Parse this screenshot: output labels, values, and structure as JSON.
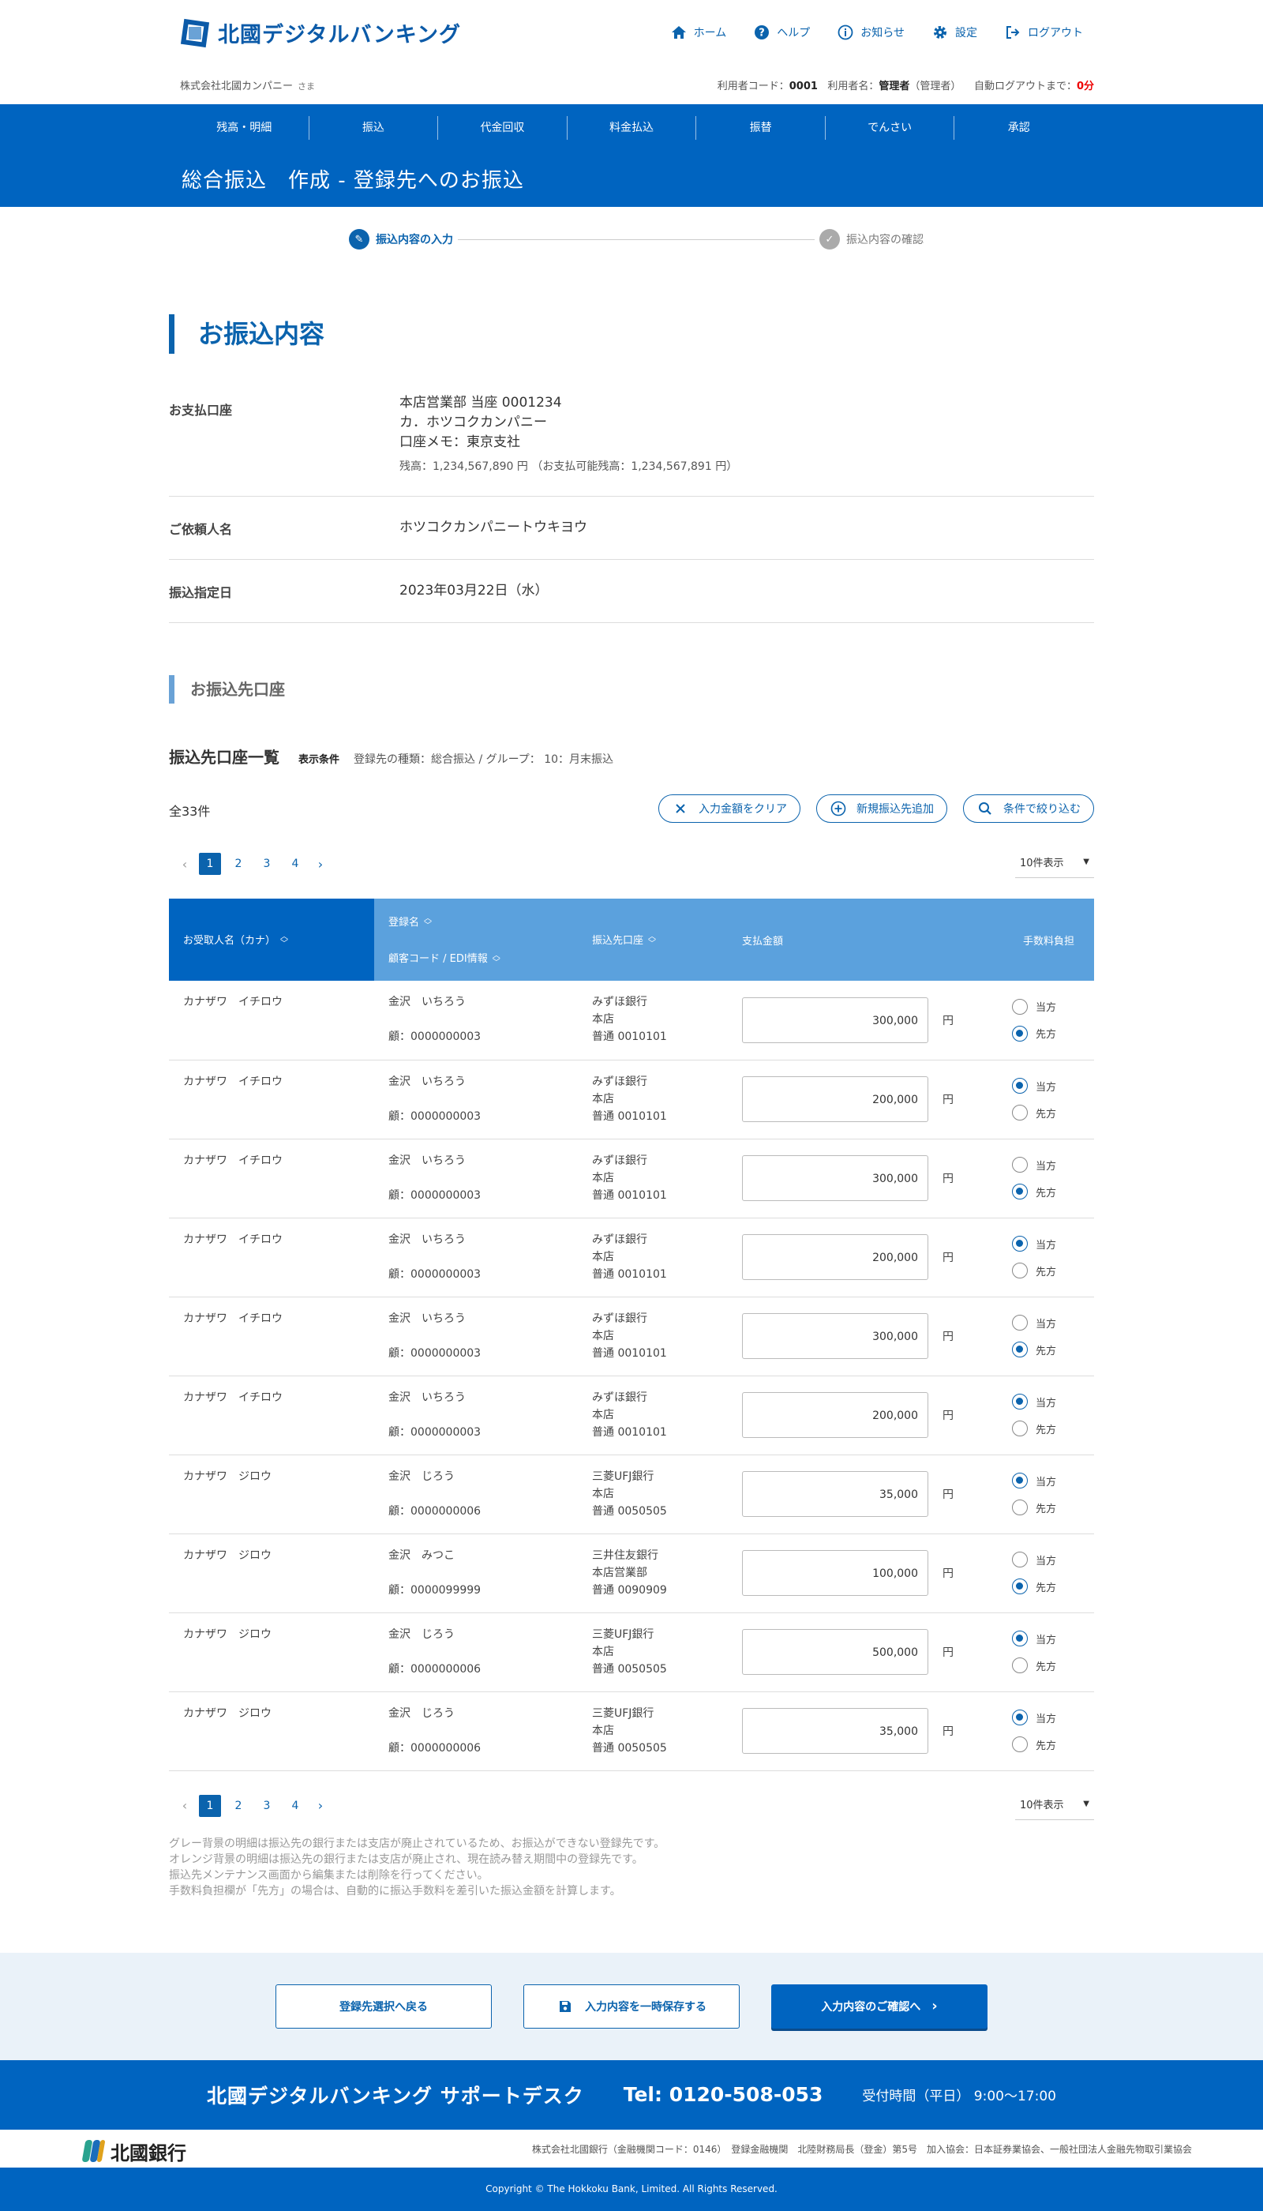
{
  "brand": {
    "name": "北國デジタルバンキング"
  },
  "topnav": [
    {
      "label": "ホーム",
      "icon": "home-icon"
    },
    {
      "label": "ヘルプ",
      "icon": "help-icon"
    },
    {
      "label": "お知らせ",
      "icon": "info-icon"
    },
    {
      "label": "設定",
      "icon": "gear-icon"
    },
    {
      "label": "ログアウト",
      "icon": "logout-icon"
    }
  ],
  "user": {
    "company": "株式会社北國カンパニー",
    "suffix": "さま",
    "code_label": "利用者コード：",
    "code": "0001",
    "name_label": "利用者名：",
    "name": "管理者",
    "role": "（管理者）",
    "logout_label": "自動ログアウトまで：",
    "logout_time": "0分"
  },
  "mainnav": [
    "残高・明細",
    "振込",
    "代金回収",
    "料金払込",
    "振替",
    "でんさい",
    "承認"
  ],
  "page_title": "総合振込　作成 - 登録先へのお振込",
  "steps": {
    "step1": "振込内容の入力",
    "step2": "振込内容の確認"
  },
  "section1": {
    "title": "お振込内容",
    "account_label": "お支払口座",
    "account_line1": "本店営業部  当座  0001234",
    "account_line2": "カ．ホツコクカンパニー",
    "account_line3": "口座メモ：東京支社",
    "balance": "残高：1,234,567,890 円 （お支払可能残高：1,234,567,891 円）",
    "requester_label": "ご依頼人名",
    "requester": "ホツコクカンパニートウキヨウ",
    "date_label": "振込指定日",
    "date": "2023年03月22日（水）"
  },
  "section2": {
    "title": "お振込先口座",
    "list_title": "振込先口座一覧",
    "cond_label": "表示条件",
    "cond": "登録先の種類：総合振込 /  グループ： 10：月末振込",
    "count": "全33件",
    "btn_clear": "入力金額をクリア",
    "btn_add": "新規振込先追加",
    "btn_filter": "条件で絞り込む",
    "pages": [
      "1",
      "2",
      "3",
      "4"
    ],
    "perpage": "10件表示"
  },
  "table": {
    "headers": {
      "kana": "お受取人名（カナ）",
      "reg": "登録名",
      "code": "顧客コード / EDI情報",
      "bank": "振込先口座",
      "amount": "支払金額",
      "fee": "手数料負担"
    },
    "yen": "円",
    "fee_this": "当方",
    "fee_other": "先方",
    "rows": [
      {
        "kana": "カナザワ　イチロウ",
        "reg": "金沢　いちろう",
        "code": "顧：0000000003",
        "bank1": "みずほ銀行",
        "bank2": "本店",
        "bank3": "普通 0010101",
        "amount": "300,000",
        "fee": "other"
      },
      {
        "kana": "カナザワ　イチロウ",
        "reg": "金沢　いちろう",
        "code": "顧：0000000003",
        "bank1": "みずほ銀行",
        "bank2": "本店",
        "bank3": "普通 0010101",
        "amount": "200,000",
        "fee": "this"
      },
      {
        "kana": "カナザワ　イチロウ",
        "reg": "金沢　いちろう",
        "code": "顧：0000000003",
        "bank1": "みずほ銀行",
        "bank2": "本店",
        "bank3": "普通 0010101",
        "amount": "300,000",
        "fee": "other"
      },
      {
        "kana": "カナザワ　イチロウ",
        "reg": "金沢　いちろう",
        "code": "顧：0000000003",
        "bank1": "みずほ銀行",
        "bank2": "本店",
        "bank3": "普通 0010101",
        "amount": "200,000",
        "fee": "this"
      },
      {
        "kana": "カナザワ　イチロウ",
        "reg": "金沢　いちろう",
        "code": "顧：0000000003",
        "bank1": "みずほ銀行",
        "bank2": "本店",
        "bank3": "普通 0010101",
        "amount": "300,000",
        "fee": "other"
      },
      {
        "kana": "カナザワ　イチロウ",
        "reg": "金沢　いちろう",
        "code": "顧：0000000003",
        "bank1": "みずほ銀行",
        "bank2": "本店",
        "bank3": "普通 0010101",
        "amount": "200,000",
        "fee": "this"
      },
      {
        "kana": "カナザワ　ジロウ",
        "reg": "金沢　じろう",
        "code": "顧：0000000006",
        "bank1": "三菱UFJ銀行",
        "bank2": "本店",
        "bank3": "普通 0050505",
        "amount": "35,000",
        "fee": "this"
      },
      {
        "kana": "カナザワ　ジロウ",
        "reg": "金沢　みつこ",
        "code": "顧：0000099999",
        "bank1": "三井住友銀行",
        "bank2": "本店営業部",
        "bank3": "普通 0090909",
        "amount": "100,000",
        "fee": "other"
      },
      {
        "kana": "カナザワ　ジロウ",
        "reg": "金沢　じろう",
        "code": "顧：0000000006",
        "bank1": "三菱UFJ銀行",
        "bank2": "本店",
        "bank3": "普通 0050505",
        "amount": "500,000",
        "fee": "this"
      },
      {
        "kana": "カナザワ　ジロウ",
        "reg": "金沢　じろう",
        "code": "顧：0000000006",
        "bank1": "三菱UFJ銀行",
        "bank2": "本店",
        "bank3": "普通 0050505",
        "amount": "35,000",
        "fee": "this"
      }
    ]
  },
  "notes": [
    "グレー背景の明細は振込先の銀行または支店が廃止されているため、お振込ができない登録先です。",
    "オレンジ背景の明細は振込先の銀行または支店が廃止され、現在読み替え期間中の登録先です。",
    "振込先メンテナンス画面から編集または削除を行ってください。",
    "手数料負担欄が「先方」の場合は、自動的に振込手数料を差引いた振込金額を計算します。"
  ],
  "actions": {
    "back": "登録先選択へ戻る",
    "save": "入力内容を一時保存する",
    "confirm": "入力内容のご確認へ"
  },
  "footer": {
    "support": "北國デジタルバンキング サポートデスク",
    "tel": "Tel: 0120-508-053",
    "hours": "受付時間（平日）  9:00～17:00",
    "bank": "北國銀行",
    "corp": "株式会社北國銀行（金融機関コード：0146）　登録金融機関　北陸財務局長（登金）第5号　加入協会：日本証券業協会、一般社団法人金融先物取引業協会",
    "copyright": "Copyright © The Hokkoku Bank, Limited. All Rights Reserved."
  },
  "colors": {
    "primary": "#0064c0",
    "header_light": "#5ba1dd",
    "accent_red": "#e00000"
  }
}
